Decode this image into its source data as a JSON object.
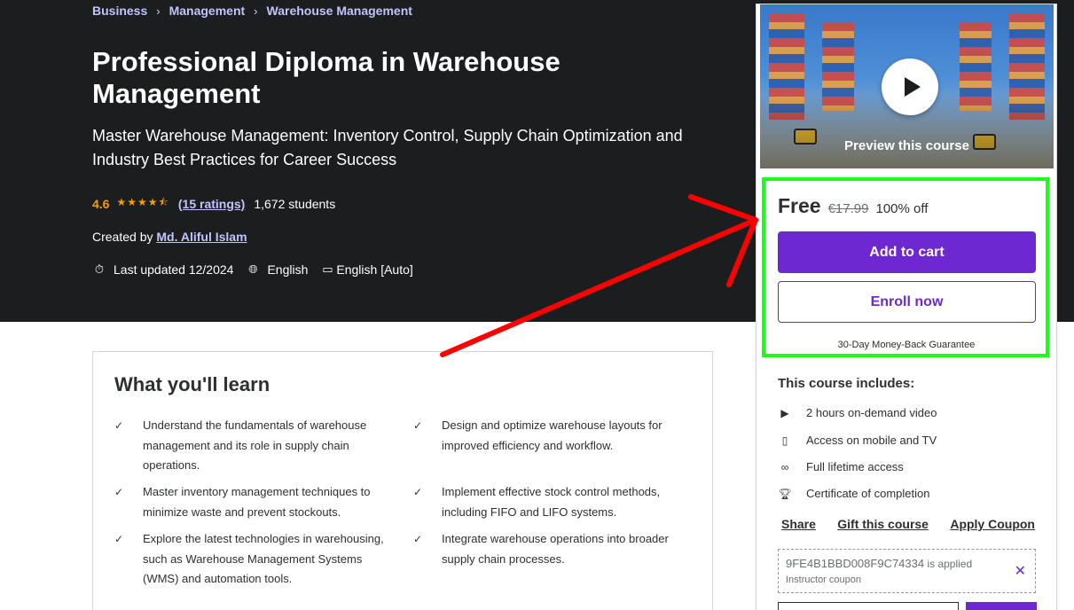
{
  "breadcrumb": [
    "Business",
    "Management",
    "Warehouse Management"
  ],
  "course": {
    "title": "Professional Diploma in Warehouse Management",
    "subtitle": "Master Warehouse Management: Inventory Control, Supply Chain Optimization and Industry Best Practices for Career Success",
    "rating": "4.6",
    "ratings_count": "(15 ratings)",
    "students": "1,672 students",
    "created_by_label": "Created by",
    "instructor": "Md. Aliful Islam",
    "last_updated": "Last updated 12/2024",
    "language": "English",
    "captions": "English [Auto]"
  },
  "learn": {
    "heading": "What you'll learn",
    "items": [
      "Understand the fundamentals of warehouse management and its role in supply chain operations.",
      "Design and optimize warehouse layouts for improved efficiency and workflow.",
      "Master inventory management techniques to minimize waste and prevent stockouts.",
      "Implement effective stock control methods, including FIFO and LIFO systems.",
      "Explore the latest technologies in warehousing, such as Warehouse Management Systems (WMS) and automation tools.",
      "Integrate warehouse operations into broader supply chain processes."
    ]
  },
  "sidebar": {
    "preview_label": "Preview this course",
    "price": "Free",
    "original_price": "€17.99",
    "discount": "100% off",
    "add_to_cart": "Add to cart",
    "enroll_now": "Enroll now",
    "guarantee": "30-Day Money-Back Guarantee",
    "includes_title": "This course includes:",
    "includes": [
      {
        "icon": "video-icon",
        "text": "2 hours on-demand video"
      },
      {
        "icon": "mobile-icon",
        "text": "Access on mobile and TV"
      },
      {
        "icon": "infinity-icon",
        "text": "Full lifetime access"
      },
      {
        "icon": "trophy-icon",
        "text": "Certificate of completion"
      }
    ],
    "share": "Share",
    "gift": "Gift this course",
    "apply_coupon": "Apply Coupon",
    "coupon_code": "9FE4B1BBD008F9C74334",
    "coupon_applied": "is applied",
    "coupon_type": "Instructor coupon"
  },
  "colors": {
    "hero_bg": "#1c1d1f",
    "accent": "#6d28d2",
    "link": "#c0c4fc",
    "rating": "#f69c08",
    "annotation_box": "#1aff1a",
    "annotation_arrow": "#ff0000"
  }
}
